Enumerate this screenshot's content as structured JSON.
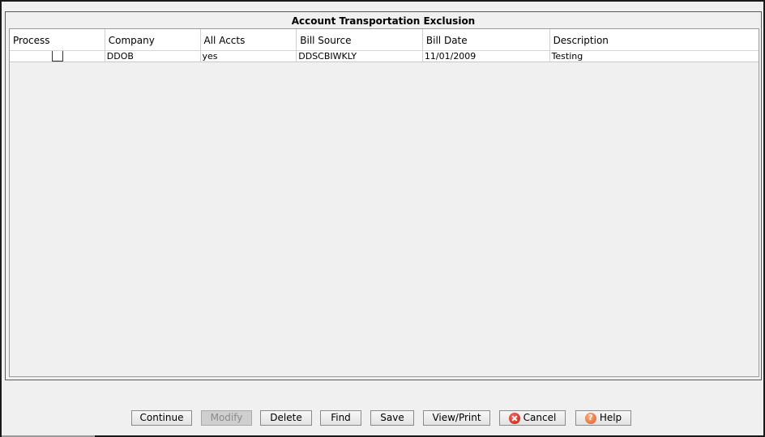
{
  "panel": {
    "title": "Account Transportation Exclusion"
  },
  "table": {
    "columns": [
      "Process",
      "Company",
      "All Accts",
      "Bill Source",
      "Bill Date",
      "Description"
    ],
    "rows": [
      {
        "process": false,
        "company": "DDOB",
        "all_accts": "yes",
        "bill_source": "DDSCBIWKLY",
        "bill_date": "11/01/2009",
        "description": "Testing"
      }
    ]
  },
  "buttons": {
    "continue": "Continue",
    "modify": "Modify",
    "delete": "Delete",
    "find": "Find",
    "save": "Save",
    "view_print": "View/Print",
    "cancel": "Cancel",
    "help": "Help"
  },
  "icons": {
    "cancel": "cancel-icon",
    "help": "help-icon"
  },
  "colors": {
    "cancel_icon": "#c0180c",
    "help_icon": "#e2552a",
    "disabled_button": "#cfcfcf"
  }
}
